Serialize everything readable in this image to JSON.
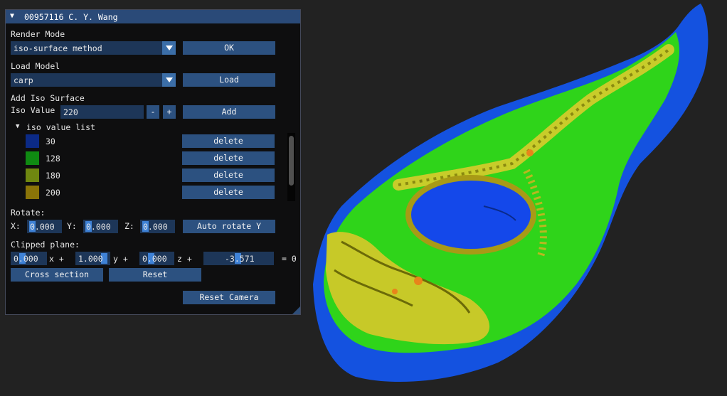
{
  "window": {
    "title": "00957116 C. Y. Wang",
    "collapse_icon": "triangle-down-icon"
  },
  "render_mode": {
    "label": "Render Mode",
    "selected": "iso-surface method",
    "ok_label": "OK"
  },
  "load_model": {
    "label": "Load Model",
    "selected": "carp",
    "load_label": "Load"
  },
  "add_iso": {
    "label": "Add Iso Surface",
    "iso_label": "Iso Value",
    "iso_value": "220",
    "minus_label": "-",
    "plus_label": "+",
    "add_label": "Add"
  },
  "iso_list": {
    "header": "iso value list",
    "items": [
      {
        "value": "30",
        "color": "#0b2a86",
        "delete_label": "delete"
      },
      {
        "value": "128",
        "color": "#0f8a12",
        "delete_label": "delete"
      },
      {
        "value": "180",
        "color": "#6f8710",
        "delete_label": "delete"
      },
      {
        "value": "200",
        "color": "#8a7408",
        "delete_label": "delete"
      }
    ]
  },
  "rotate": {
    "label": "Rotate:",
    "x_label": "X:",
    "x_value": "0.000",
    "y_label": "Y:",
    "y_value": "0.000",
    "z_label": "Z:",
    "z_value": "0.000",
    "auto_label": "Auto rotate Y"
  },
  "clip": {
    "label": "Clipped plane:",
    "a": "0.000",
    "b": "1.000",
    "c": "0.000",
    "d": "-3.571",
    "x_term": "x +",
    "y_term": "y +",
    "z_term": "z +",
    "eq": "= 0",
    "cross_label": "Cross section",
    "reset_label": "Reset"
  },
  "reset_camera_label": "Reset Camera",
  "colors": {
    "panel_bg": "#0e0e0f",
    "title_bar": "#2a4a78",
    "button": "#2c5180",
    "field": "#1d3658",
    "accent": "#3f82d6"
  }
}
